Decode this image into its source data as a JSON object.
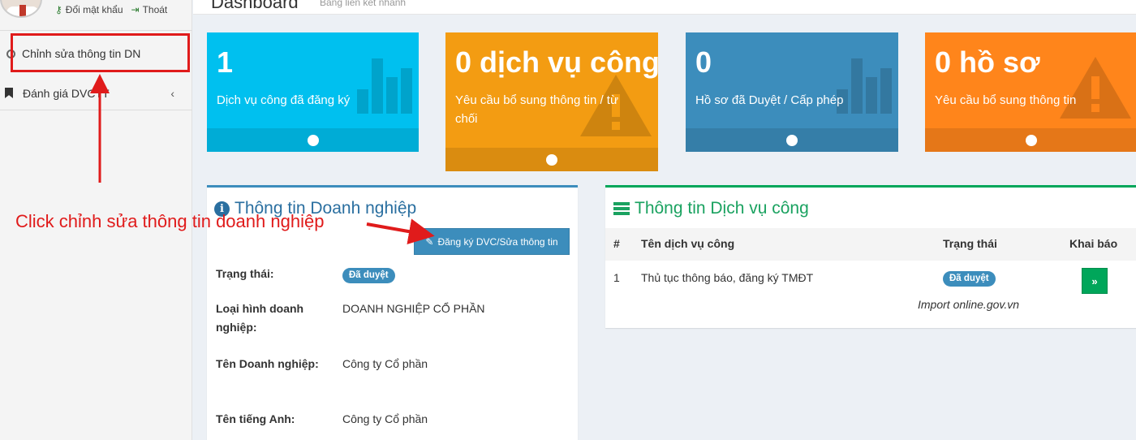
{
  "sidebar": {
    "user_links": {
      "change_password": "Đổi mật khẩu",
      "logout": "Thoát"
    },
    "items": [
      {
        "label": "Chỉnh sửa thông tin DN",
        "icon": "circle-icon"
      },
      {
        "label": "Đánh giá DVCTT",
        "icon": "bookmark-icon"
      }
    ]
  },
  "header": {
    "title": "Dashboard",
    "subtitle": "Bảng liên kết nhanh"
  },
  "info_boxes": [
    {
      "number": "1",
      "text": "Dịch vụ công đã đăng ký",
      "color": "#00c0ef",
      "icon": "bar-chart-icon"
    },
    {
      "number": "0 dịch vụ công",
      "text": "Yêu cầu bổ sung thông tin / từ chối",
      "color": "#f39c12",
      "icon": "warning-icon"
    },
    {
      "number": "0",
      "text": "Hồ sơ đã Duyệt / Cấp phép",
      "color": "#3c8dbc",
      "icon": "bar-chart-icon"
    },
    {
      "number": "0 hồ sơ",
      "text": "Yêu cầu bổ sung thông tin",
      "color": "#ff851b",
      "icon": "warning-icon"
    }
  ],
  "company_panel": {
    "title": "Thông tin Doanh nghiệp",
    "edit_button": "Đăng ký DVC/Sửa thông tin",
    "fields": [
      {
        "label": "Trạng thái:",
        "value": "Đã duyệt"
      },
      {
        "label": "Loại hình doanh nghiệp:",
        "value": "DOANH NGHIỆP CỔ PHẦN"
      },
      {
        "label": "Tên Doanh nghiệp:",
        "value": "Công ty Cổ phần"
      },
      {
        "label": "Tên tiếng Anh:",
        "value": "Công ty Cổ phần"
      }
    ]
  },
  "service_panel": {
    "title": "Thông tin Dịch vụ công",
    "columns": [
      "#",
      "Tên dịch vụ công",
      "Trạng thái",
      "Khai báo"
    ],
    "rows": [
      {
        "index": "1",
        "name": "Thủ tục thông báo, đăng ký TMĐT",
        "status": "Đã duyệt",
        "source": "Import online.gov.vn",
        "action": "»"
      }
    ]
  },
  "annotation": {
    "text": "Click chỉnh sửa thông tin doanh nghiệp",
    "color": "#e01b1b"
  }
}
